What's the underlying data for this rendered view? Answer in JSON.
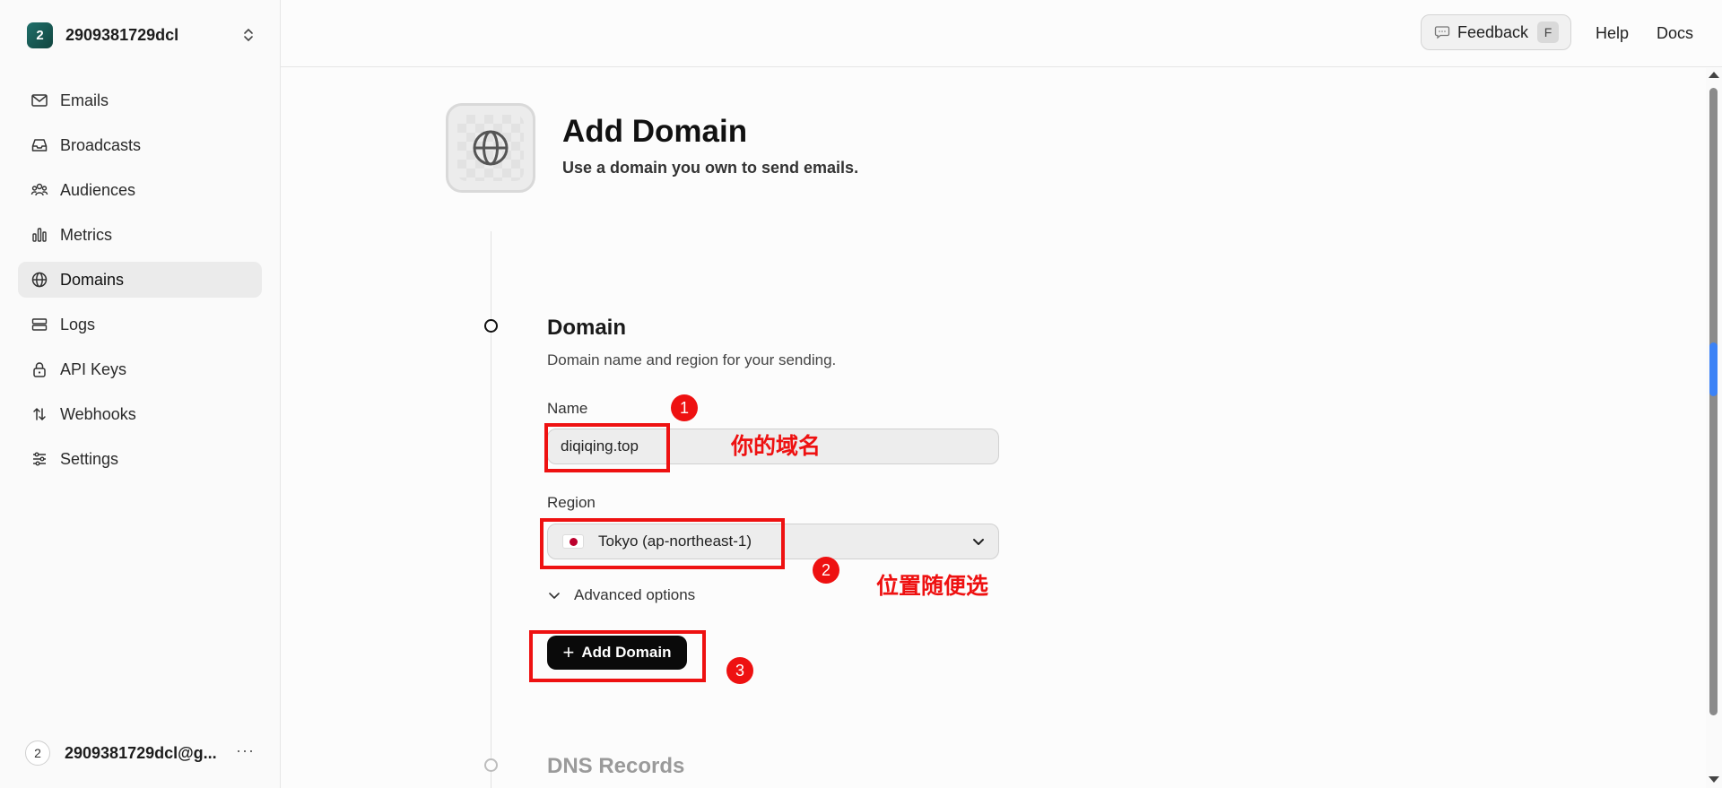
{
  "team": {
    "badge": "2",
    "name": "2909381729dcl"
  },
  "nav": [
    {
      "label": "Emails",
      "icon": "mail-icon"
    },
    {
      "label": "Broadcasts",
      "icon": "inbox-icon"
    },
    {
      "label": "Audiences",
      "icon": "users-icon"
    },
    {
      "label": "Metrics",
      "icon": "bar-chart-icon"
    },
    {
      "label": "Domains",
      "icon": "globe-icon",
      "active": true
    },
    {
      "label": "Logs",
      "icon": "logs-icon"
    },
    {
      "label": "API Keys",
      "icon": "lock-icon"
    },
    {
      "label": "Webhooks",
      "icon": "arrows-icon"
    },
    {
      "label": "Settings",
      "icon": "sliders-icon"
    }
  ],
  "user": {
    "avatar": "2",
    "email": "2909381729dcl@g...",
    "more": "···"
  },
  "topbar": {
    "feedback": "Feedback",
    "feedback_key": "F",
    "help": "Help",
    "docs": "Docs"
  },
  "header": {
    "title": "Add Domain",
    "subtitle": "Use a domain you own to send emails."
  },
  "domain_section": {
    "title": "Domain",
    "description": "Domain name and region for your sending.",
    "name_label": "Name",
    "name_value": "diqiqing.top",
    "region_label": "Region",
    "region_value": "Tokyo (ap-northeast-1)",
    "advanced": "Advanced options",
    "add_button": "Add Domain"
  },
  "dns_section": {
    "title": "DNS Records"
  },
  "annotations": [
    {
      "num": "1",
      "note": "你的域名"
    },
    {
      "num": "2",
      "note": "位置随便选"
    },
    {
      "num": "3",
      "note": ""
    }
  ],
  "colors": {
    "accent_red": "#ee1111",
    "button_black": "#0a0a0a",
    "active_nav": "#ebebeb"
  }
}
